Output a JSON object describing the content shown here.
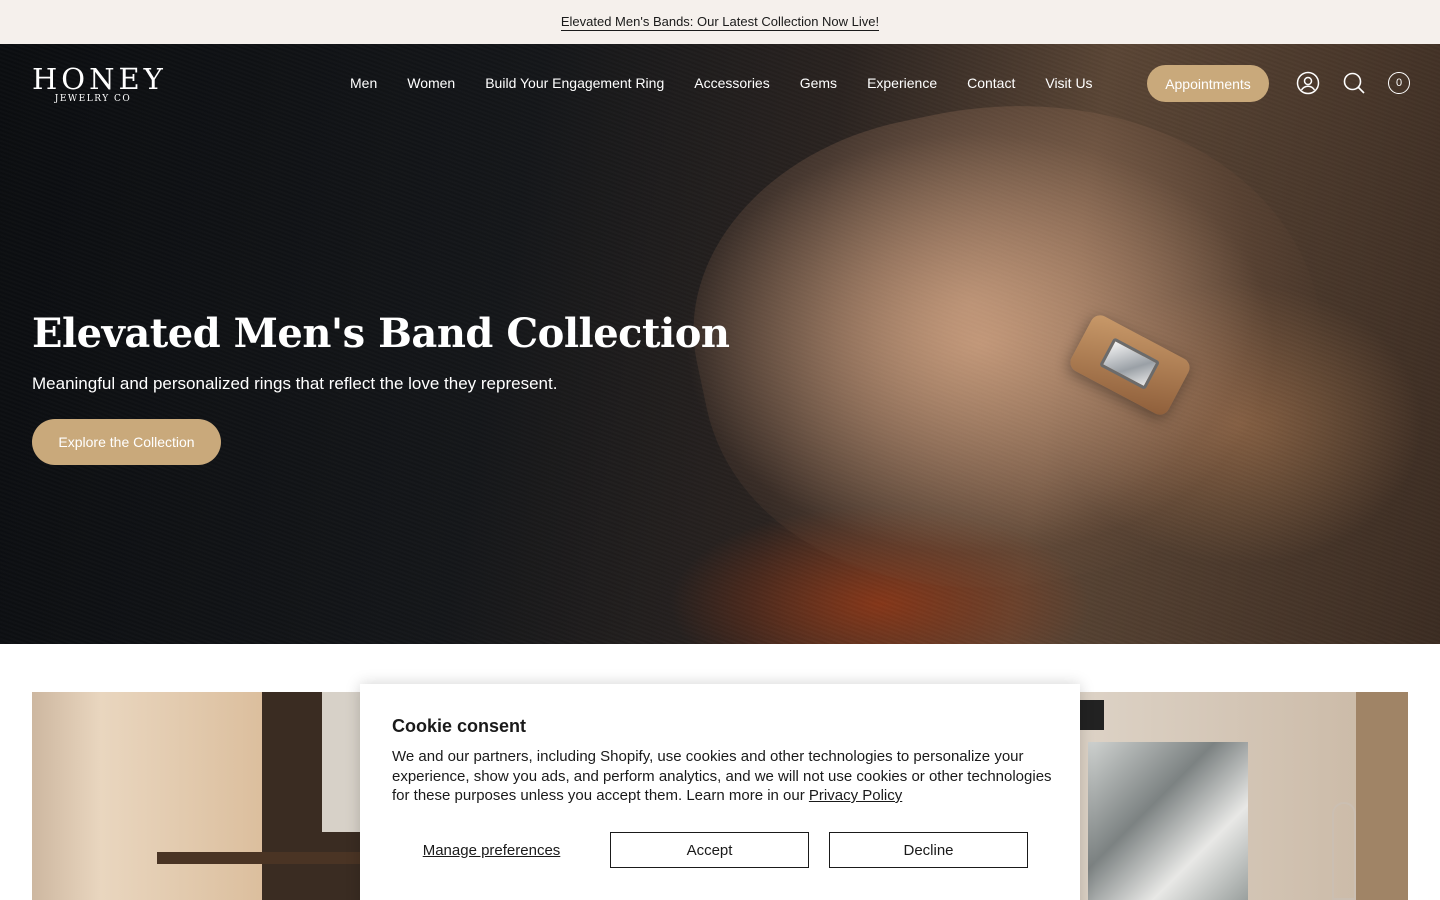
{
  "announcement": {
    "text": "Elevated Men's Bands: Our Latest Collection Now Live!"
  },
  "header": {
    "logo_main": "HONEY",
    "logo_sub": "JEWELRY CO",
    "nav": [
      "Men",
      "Women",
      "Build Your Engagement Ring",
      "Accessories",
      "Gems",
      "Experience",
      "Contact",
      "Visit Us"
    ],
    "appointments_label": "Appointments",
    "icons": [
      "account-icon",
      "search-icon",
      "cart-icon"
    ],
    "cart_count": "0"
  },
  "hero": {
    "title": "Elevated Men's Band Collection",
    "subtitle": "Meaningful and personalized rings that reflect the love they represent.",
    "cta_label": "Explore the Collection"
  },
  "cookie": {
    "title": "Cookie consent",
    "body": "We and our partners, including Shopify, use cookies and other technologies to personalize your experience, show you ads, and perform analytics, and we will not use cookies or other technologies for these purposes unless you accept them. Learn more in our",
    "privacy_link": "Privacy Policy",
    "manage_label": "Manage preferences",
    "accept_label": "Accept",
    "decline_label": "Decline"
  },
  "colors": {
    "accent": "#c9a97b",
    "announcement_bg": "#f5f0ec",
    "text": "#1a1a1a"
  }
}
